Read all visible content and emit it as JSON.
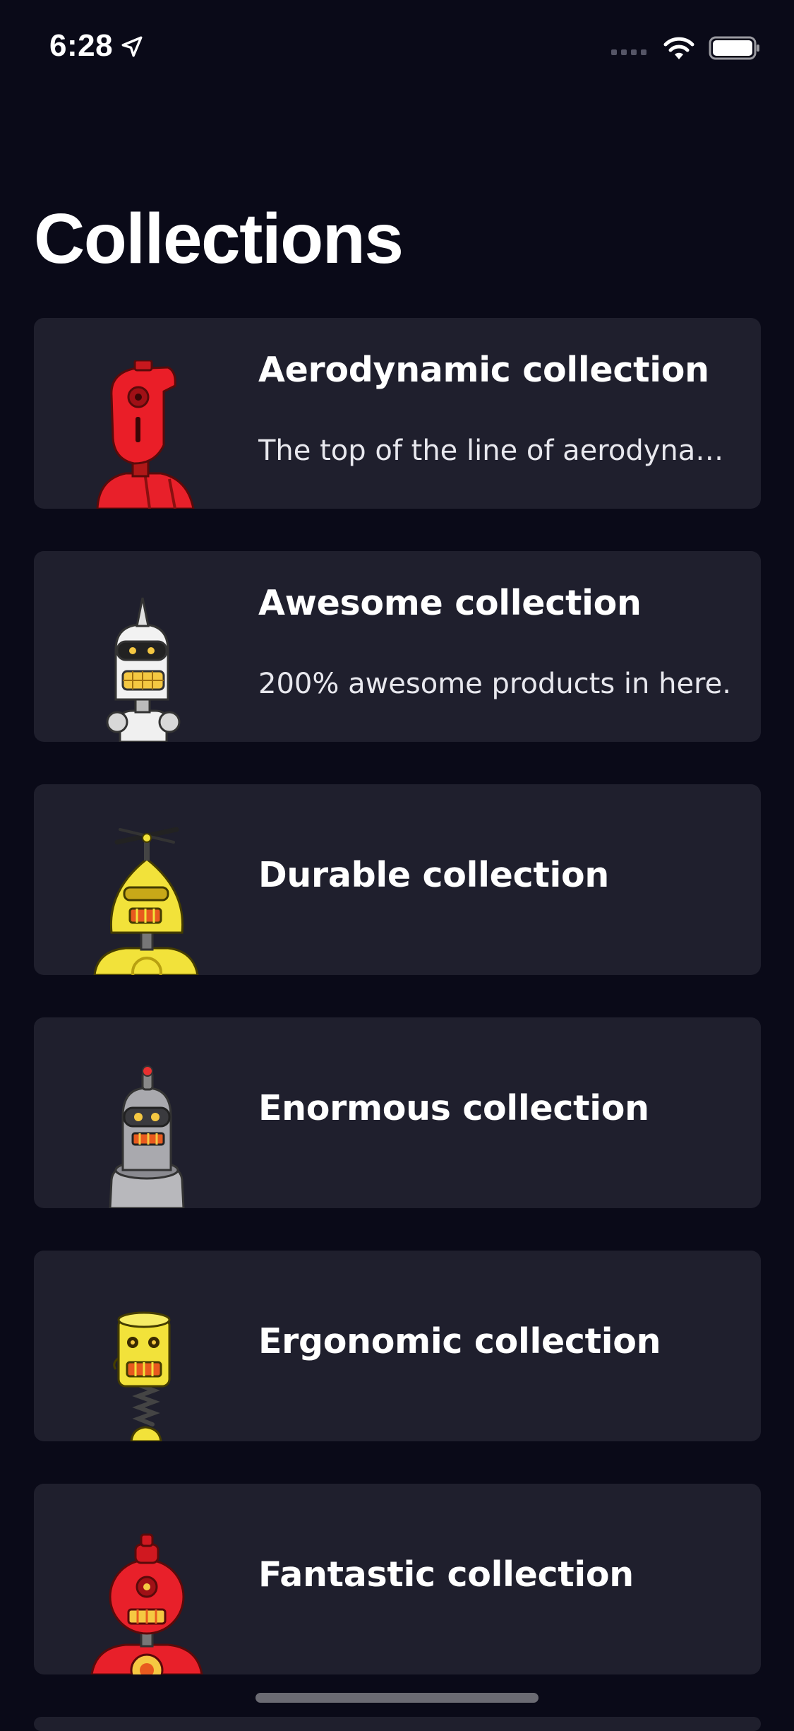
{
  "status_bar": {
    "time": "6:28",
    "icons": [
      "location-arrow-icon",
      "cellular-signal-icon",
      "wifi-icon",
      "battery-icon"
    ]
  },
  "page": {
    "title": "Collections"
  },
  "collections": [
    {
      "title": "Aerodynamic collection",
      "description": "The top of the line of aerodynamic products",
      "thumbnail": "red-robot-image"
    },
    {
      "title": "Awesome collection",
      "description": "200% awesome products in here.",
      "thumbnail": "white-robot-image"
    },
    {
      "title": "Durable collection",
      "description": "",
      "thumbnail": "yellow-propeller-robot-image"
    },
    {
      "title": "Enormous collection",
      "description": "",
      "thumbnail": "gray-robot-image"
    },
    {
      "title": "Ergonomic collection",
      "description": "",
      "thumbnail": "yellow-spring-robot-image"
    },
    {
      "title": "Fantastic collection",
      "description": "",
      "thumbnail": "red-round-robot-image"
    }
  ],
  "colors": {
    "background": "#0a0a18",
    "card": "#1f1f2d",
    "text": "#ffffff"
  }
}
